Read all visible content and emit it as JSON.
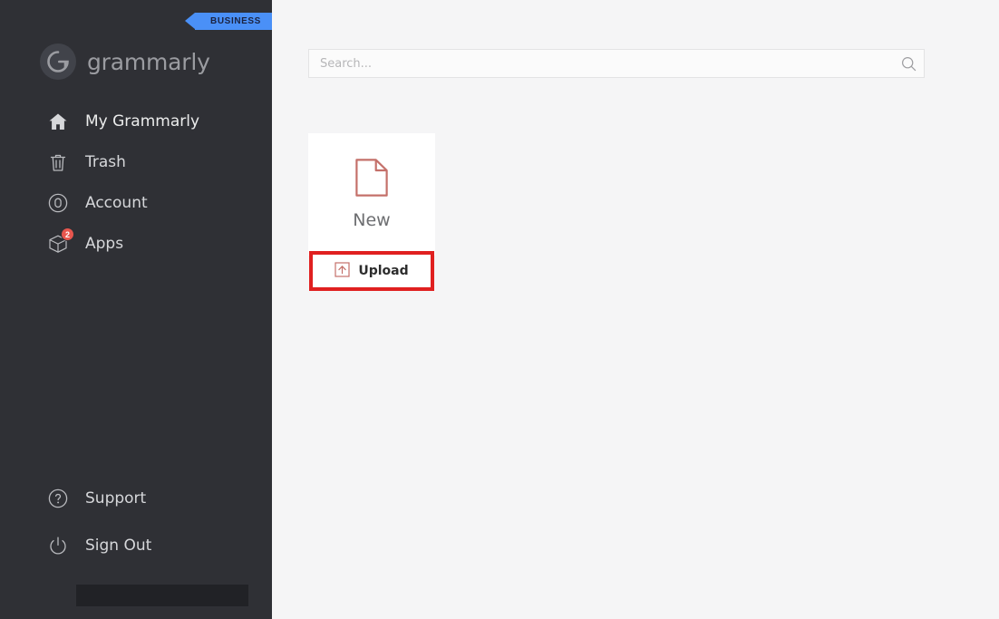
{
  "app": {
    "name": "Grammarly"
  },
  "sidebar": {
    "ribbon_label": "BUSINESS",
    "logo_text": "grammarly",
    "logo_icon": "grammarly-g-icon",
    "top_items": [
      {
        "label": "My Grammarly",
        "icon": "home-icon",
        "active": true,
        "badge": ""
      },
      {
        "label": "Trash",
        "icon": "trash-icon",
        "active": false,
        "badge": ""
      },
      {
        "label": "Account",
        "icon": "account-icon",
        "active": false,
        "badge": ""
      },
      {
        "label": "Apps",
        "icon": "cube-icon",
        "active": false,
        "badge": "2"
      }
    ],
    "bottom_items": [
      {
        "label": "Support",
        "icon": "question-circle-icon",
        "active": false,
        "badge": ""
      },
      {
        "label": "Sign Out",
        "icon": "power-icon",
        "active": false,
        "badge": ""
      }
    ],
    "redaction": {
      "name": "redacted-bar"
    }
  },
  "main": {
    "search": {
      "value": "",
      "placeholder": "Search...",
      "icon": "search-icon"
    },
    "new_card": {
      "label": "New",
      "icon": "document-icon"
    },
    "upload": {
      "label": "Upload",
      "icon": "upload-arrow-icon",
      "highlighted": true
    }
  },
  "colors": {
    "sidebar_bg": "#2f3035",
    "content_bg": "#f5f5f6",
    "card_bg": "#ffffff",
    "ribbon_bg": "#4a90f7",
    "accent_red": "#c4706a",
    "highlight_red": "#e02020",
    "badge_red": "#e8564e",
    "nav_text": "#d6d7da"
  }
}
